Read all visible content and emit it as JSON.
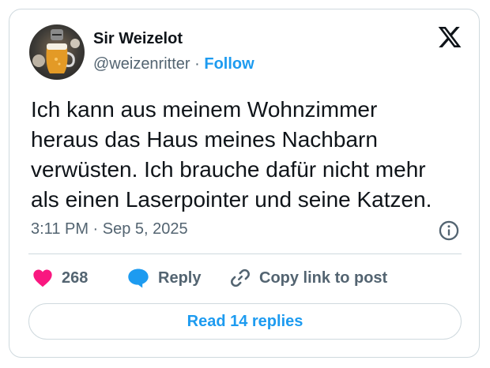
{
  "author": {
    "display_name": "Sir Weizelot",
    "handle": "@weizenritter",
    "separator": "·",
    "follow_label": "Follow"
  },
  "tweet": {
    "text_lines": [
      "Ich kann aus meinem Wohnzimmer",
      "heraus das Haus meines Nachbarn",
      "verwüsten. Ich brauche dafür nicht mehr",
      "als einen Laserpointer und seine Katzen."
    ],
    "timestamp": "3:11 PM · Sep 5, 2025"
  },
  "actions": {
    "like_count": "268",
    "reply_label": "Reply",
    "copy_link_label": "Copy link to post"
  },
  "footer": {
    "read_replies_label": "Read 14 replies"
  },
  "icons": {
    "platform": "x-logo-icon",
    "info": "info-icon",
    "like": "heart-icon",
    "reply": "speech-bubble-icon",
    "copy_link": "link-icon"
  },
  "colors": {
    "accent": "#1d9bf0",
    "like": "#f91880",
    "secondary_text": "#536471",
    "primary_text": "#0f1419",
    "border": "#cfd9de"
  }
}
